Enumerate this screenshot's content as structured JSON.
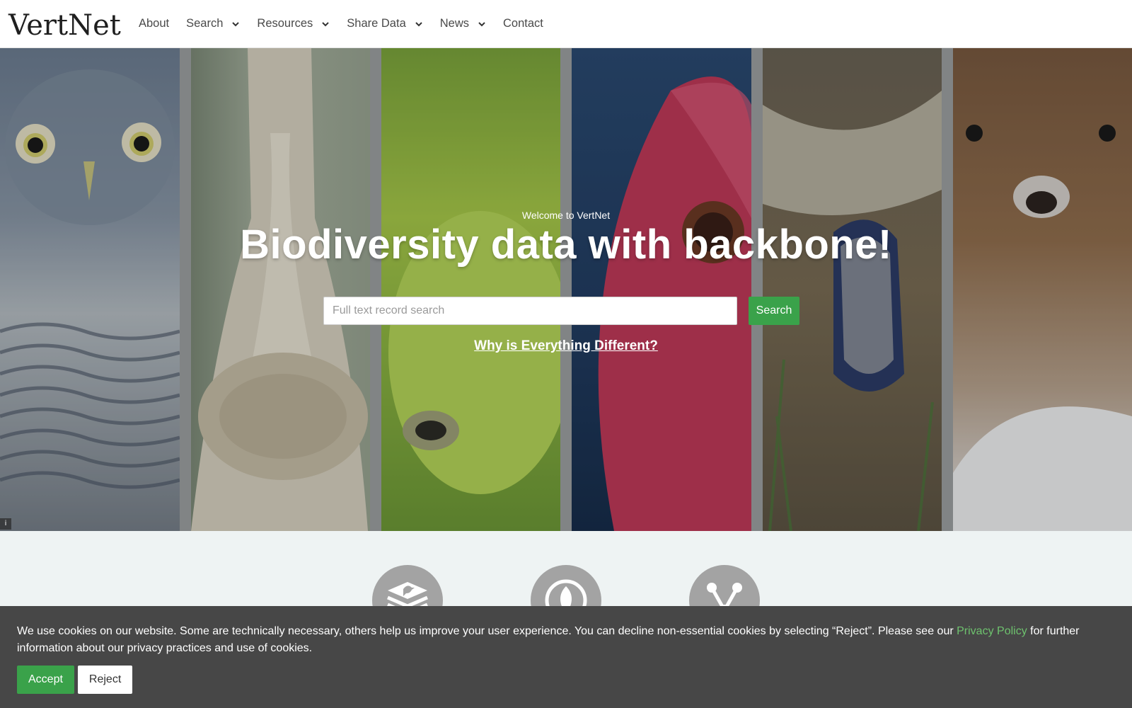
{
  "header": {
    "logo_prefix": "Ver",
    "logo_t": "t",
    "logo_ne": "Ne",
    "logo_suffix": "t",
    "nav": [
      {
        "label": "About",
        "has_dropdown": false
      },
      {
        "label": "Search",
        "has_dropdown": true
      },
      {
        "label": "Resources",
        "has_dropdown": true
      },
      {
        "label": "Share Data",
        "has_dropdown": true
      },
      {
        "label": "News",
        "has_dropdown": true
      },
      {
        "label": "Contact",
        "has_dropdown": false
      }
    ]
  },
  "hero": {
    "welcome": "Welcome to VertNet",
    "headline": "Biodiversity data with backbone!",
    "search_placeholder": "Full text record search",
    "search_button": "Search",
    "why_link": "Why is Everything Different?",
    "info_icon": "i",
    "panels": [
      "owl",
      "bone",
      "frog",
      "fish",
      "snake",
      "mammal"
    ]
  },
  "features": [
    {
      "icon": "database-bird-icon"
    },
    {
      "icon": "leaf-icon"
    },
    {
      "icon": "network-icon"
    }
  ],
  "cookie_banner": {
    "text_before": "We use cookies on our website. Some are technically necessary, others help us improve your user experience. You can decline non-essential cookies by selecting “Reject”. Please see our ",
    "policy_link": "Privacy Policy",
    "text_after": " for further information about our privacy practices and use of cookies.",
    "accept": "Accept",
    "reject": "Reject"
  },
  "colors": {
    "accent_green": "#3aa24a",
    "banner_bg": "#474747",
    "link_green": "#6ec26e",
    "page_bg": "#eef3f3"
  }
}
